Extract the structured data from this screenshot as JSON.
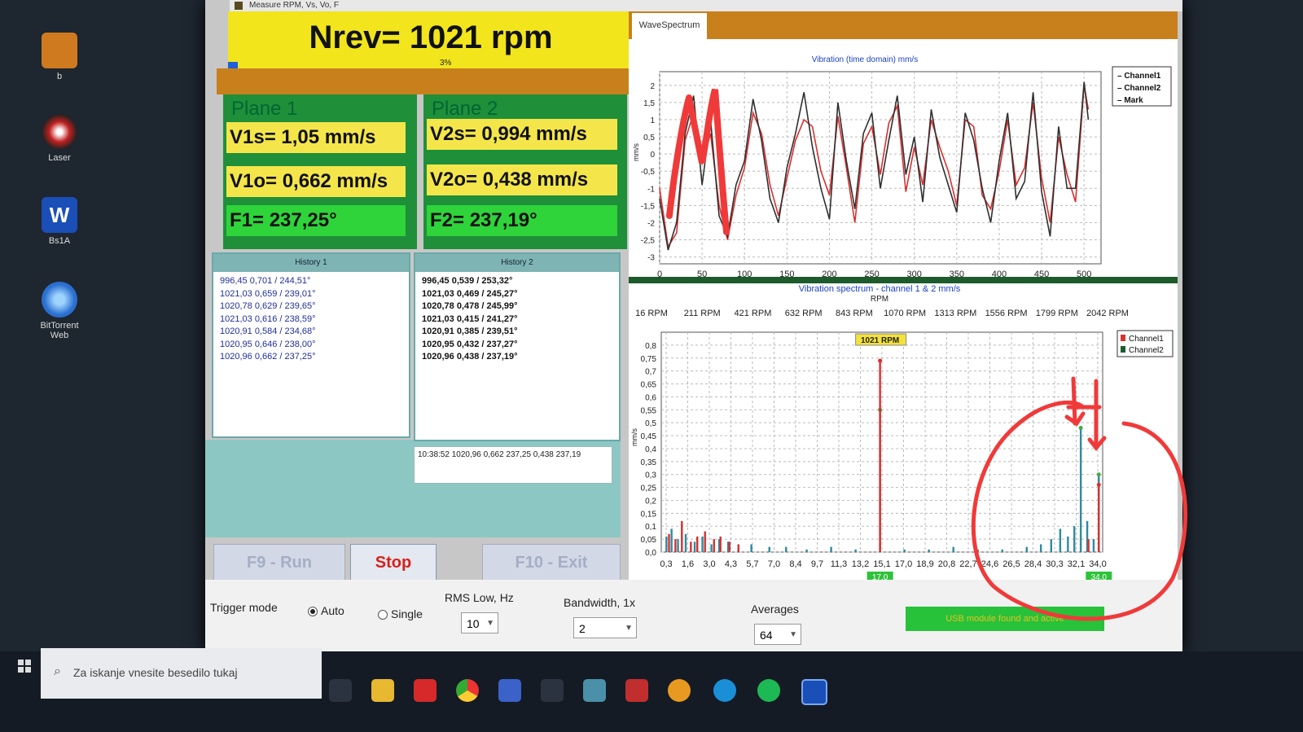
{
  "desktop": {
    "icons": [
      {
        "label": "b"
      },
      {
        "label": "Laser"
      },
      {
        "label": "Bs1A"
      },
      {
        "label": "BitTorrent Web"
      }
    ]
  },
  "window": {
    "title": "Measure RPM, Vs, Vo, F"
  },
  "rpm": {
    "text": "Nrev= 1021 rpm",
    "percent": "3%"
  },
  "plane1": {
    "title": "Plane 1",
    "vs": "V1s= 1,05 mm/s",
    "vo": "V1o= 0,662 mm/s",
    "f": "F1= 237,25°"
  },
  "plane2": {
    "title": "Plane 2",
    "vs": "V2s= 0,994 mm/s",
    "vo": "V2o= 0,438 mm/s",
    "f": "F2= 237,19°"
  },
  "history1": {
    "title": "History 1",
    "rows": [
      "996,45 0,701 / 244,51°",
      "1021,03 0,659 / 239,01°",
      "1020,78 0,629 / 239,65°",
      "1021,03 0,616 / 238,59°",
      "1020,91 0,584 / 234,68°",
      "1020,95 0,646 / 238,00°",
      "1020,96 0,662 / 237,25°"
    ]
  },
  "history2": {
    "title": "History 2",
    "rows": [
      "996,45 0,539 / 253,32°",
      "1021,03 0,469 / 245,27°",
      "1020,78 0,478 / 245,99°",
      "1021,03 0,415 / 241,27°",
      "1020,91 0,385 / 239,51°",
      "1020,95 0,432 / 237,27°",
      "1020,96 0,438 / 237,19°"
    ]
  },
  "log": {
    "text": "10:38:52 1020,96 0,662 237,25 0,438 237,19"
  },
  "buttons": {
    "run": "F9 - Run",
    "stop": "Stop",
    "exit": "F10 - Exit"
  },
  "controls": {
    "trigger_label": "Trigger mode",
    "auto": "Auto",
    "single": "Single",
    "rms_label": "RMS Low, Hz",
    "rms_value": "10",
    "bandwidth_label": "Bandwidth, 1x",
    "bandwidth_value": "2",
    "averages_label": "Averages",
    "averages_value": "64",
    "status_text": "USB module found and active"
  },
  "tab": {
    "label": "WaveSpectrum"
  },
  "chart_data": [
    {
      "type": "line",
      "title": "Vibration (time domain) mm/s",
      "ylabel": "mm/s",
      "xlim": [
        0,
        520
      ],
      "ylim": [
        -3.2,
        2.4
      ],
      "xticks": [
        0,
        50,
        100,
        150,
        200,
        250,
        300,
        350,
        400,
        450,
        500
      ],
      "yticks": [
        2,
        1.5,
        1,
        0.5,
        0,
        -0.5,
        -1,
        -1.5,
        -2,
        -2.5,
        -3
      ],
      "ytick_labels": [
        "2",
        "1,5",
        "1",
        "0,5",
        "0",
        "-0,5",
        "-1",
        "-1,5",
        "-2",
        "-2,5",
        "-3"
      ],
      "legend": [
        "Channel1",
        "Channel2",
        "Mark"
      ],
      "legend_placement": "top-right",
      "grid": true,
      "series": [
        {
          "name": "Channel1",
          "color": "#d83030",
          "x": [
            0,
            10,
            20,
            30,
            40,
            50,
            60,
            70,
            80,
            90,
            100,
            110,
            120,
            130,
            140,
            150,
            160,
            170,
            180,
            190,
            200,
            210,
            220,
            230,
            240,
            250,
            260,
            270,
            280,
            290,
            300,
            310,
            320,
            330,
            340,
            350,
            360,
            370,
            380,
            390,
            400,
            410,
            420,
            430,
            440,
            450,
            460,
            470,
            480,
            490,
            500,
            505
          ],
          "y": [
            -1.0,
            -2.7,
            -2.3,
            0.4,
            1.2,
            -0.3,
            0.6,
            -1.5,
            -2.5,
            -1.2,
            -0.4,
            1.2,
            0.6,
            -0.9,
            -1.8,
            -0.7,
            0.4,
            1.0,
            0.8,
            -0.5,
            -1.2,
            1.1,
            -0.4,
            -2.0,
            0.3,
            0.8,
            -0.6,
            0.9,
            1.4,
            -1.1,
            0.2,
            -0.9,
            1.0,
            0.2,
            -0.5,
            -1.5,
            1.0,
            0.8,
            -1.2,
            -1.6,
            -0.5,
            1.0,
            -0.9,
            -0.4,
            1.5,
            -0.7,
            -2.0,
            0.5,
            -0.6,
            -1.4,
            2.0,
            1.3
          ]
        },
        {
          "name": "Channel2",
          "color": "#303030",
          "x": [
            0,
            10,
            20,
            30,
            40,
            50,
            60,
            70,
            80,
            90,
            100,
            110,
            120,
            130,
            140,
            150,
            160,
            170,
            180,
            190,
            200,
            210,
            220,
            230,
            240,
            250,
            260,
            270,
            280,
            290,
            300,
            310,
            320,
            330,
            340,
            350,
            360,
            370,
            380,
            390,
            400,
            410,
            420,
            430,
            440,
            450,
            460,
            470,
            480,
            490,
            500,
            505
          ],
          "y": [
            -1.3,
            -2.8,
            -2.0,
            0.6,
            1.7,
            -0.9,
            1.0,
            -1.8,
            -2.4,
            -0.9,
            -0.2,
            1.6,
            0.4,
            -1.3,
            -2.0,
            -0.4,
            0.6,
            1.8,
            0.2,
            -1.0,
            -1.9,
            1.5,
            -0.2,
            -1.6,
            0.6,
            1.2,
            -1.0,
            0.4,
            1.7,
            -0.6,
            0.5,
            -1.4,
            1.3,
            -0.1,
            -0.9,
            -1.7,
            1.2,
            0.4,
            -1.0,
            -2.0,
            -0.2,
            1.2,
            -1.3,
            -0.8,
            1.8,
            -1.1,
            -2.4,
            0.8,
            -1.0,
            -1.0,
            2.1,
            1.0
          ]
        }
      ]
    },
    {
      "type": "bar",
      "title": "Vibration spectrum - channel 1 & 2 mm/s",
      "top_axis_label": "RPM",
      "top_ticks": [
        "16 RPM",
        "211 RPM",
        "421 RPM",
        "632 RPM",
        "843 RPM",
        "1070 RPM",
        "1313 RPM",
        "1556 RPM",
        "1799 RPM",
        "2042 RPM"
      ],
      "x_tick_labels": [
        "0,3",
        "1,6",
        "3,0",
        "4,3",
        "5,7",
        "7,0",
        "8,4",
        "9,7",
        "11,3",
        "13,2",
        "15,1",
        "17,0",
        "18,9",
        "20,8",
        "22,7",
        "24,6",
        "26,5",
        "28,4",
        "30,3",
        "32,1",
        "34,0"
      ],
      "ylabel": "mm/s",
      "ylim": [
        0,
        0.85
      ],
      "yticks": [
        0.8,
        0.75,
        0.7,
        0.65,
        0.6,
        0.55,
        0.5,
        0.45,
        0.4,
        0.35,
        0.3,
        0.25,
        0.2,
        0.15,
        0.1,
        0.05,
        0.0
      ],
      "ytick_labels": [
        "0,8",
        "0,75",
        "0,7",
        "0,65",
        "0,6",
        "0,55",
        "0,5",
        "0,45",
        "0,4",
        "0,35",
        "0,3",
        "0,25",
        "0,2",
        "0,15",
        "0,1",
        "0,05",
        "0,0"
      ],
      "marker_label": "1021 RPM",
      "marker_x_label": "17,0",
      "end_x_label": "34,0",
      "legend": [
        "Channel1",
        "Channel2"
      ],
      "legend_placement": "top-right",
      "grid": true,
      "series": [
        {
          "name": "Channel1",
          "color": "#d83030",
          "x": [
            0.6,
            1.1,
            1.6,
            2.3,
            2.8,
            3.4,
            4.1,
            4.6,
            5.3,
            6.0,
            17.0,
            33.2,
            34.0
          ],
          "values": [
            0.07,
            0.05,
            0.12,
            0.04,
            0.06,
            0.08,
            0.05,
            0.06,
            0.04,
            0.03,
            0.74,
            0.05,
            0.26
          ]
        },
        {
          "name": "Channel2",
          "color": "#2f8aa0",
          "x": [
            0.4,
            0.8,
            1.3,
            1.9,
            2.6,
            3.2,
            3.9,
            4.5,
            5.2,
            6.0,
            7.0,
            8.4,
            9.7,
            11.3,
            13.2,
            15.1,
            17.0,
            18.9,
            20.8,
            22.7,
            24.6,
            26.5,
            28.4,
            29.5,
            30.3,
            31.0,
            31.6,
            32.1,
            32.6,
            33.1,
            33.6,
            34.0
          ],
          "values": [
            0.06,
            0.09,
            0.05,
            0.07,
            0.04,
            0.06,
            0.03,
            0.05,
            0.04,
            0.03,
            0.03,
            0.02,
            0.02,
            0.01,
            0.02,
            0.01,
            0.55,
            0.01,
            0.01,
            0.02,
            0.01,
            0.01,
            0.02,
            0.03,
            0.05,
            0.09,
            0.06,
            0.1,
            0.48,
            0.12,
            0.05,
            0.3
          ]
        }
      ]
    }
  ],
  "taskbar": {
    "search_placeholder": "Za iskanje vnesite besedilo tukaj"
  }
}
